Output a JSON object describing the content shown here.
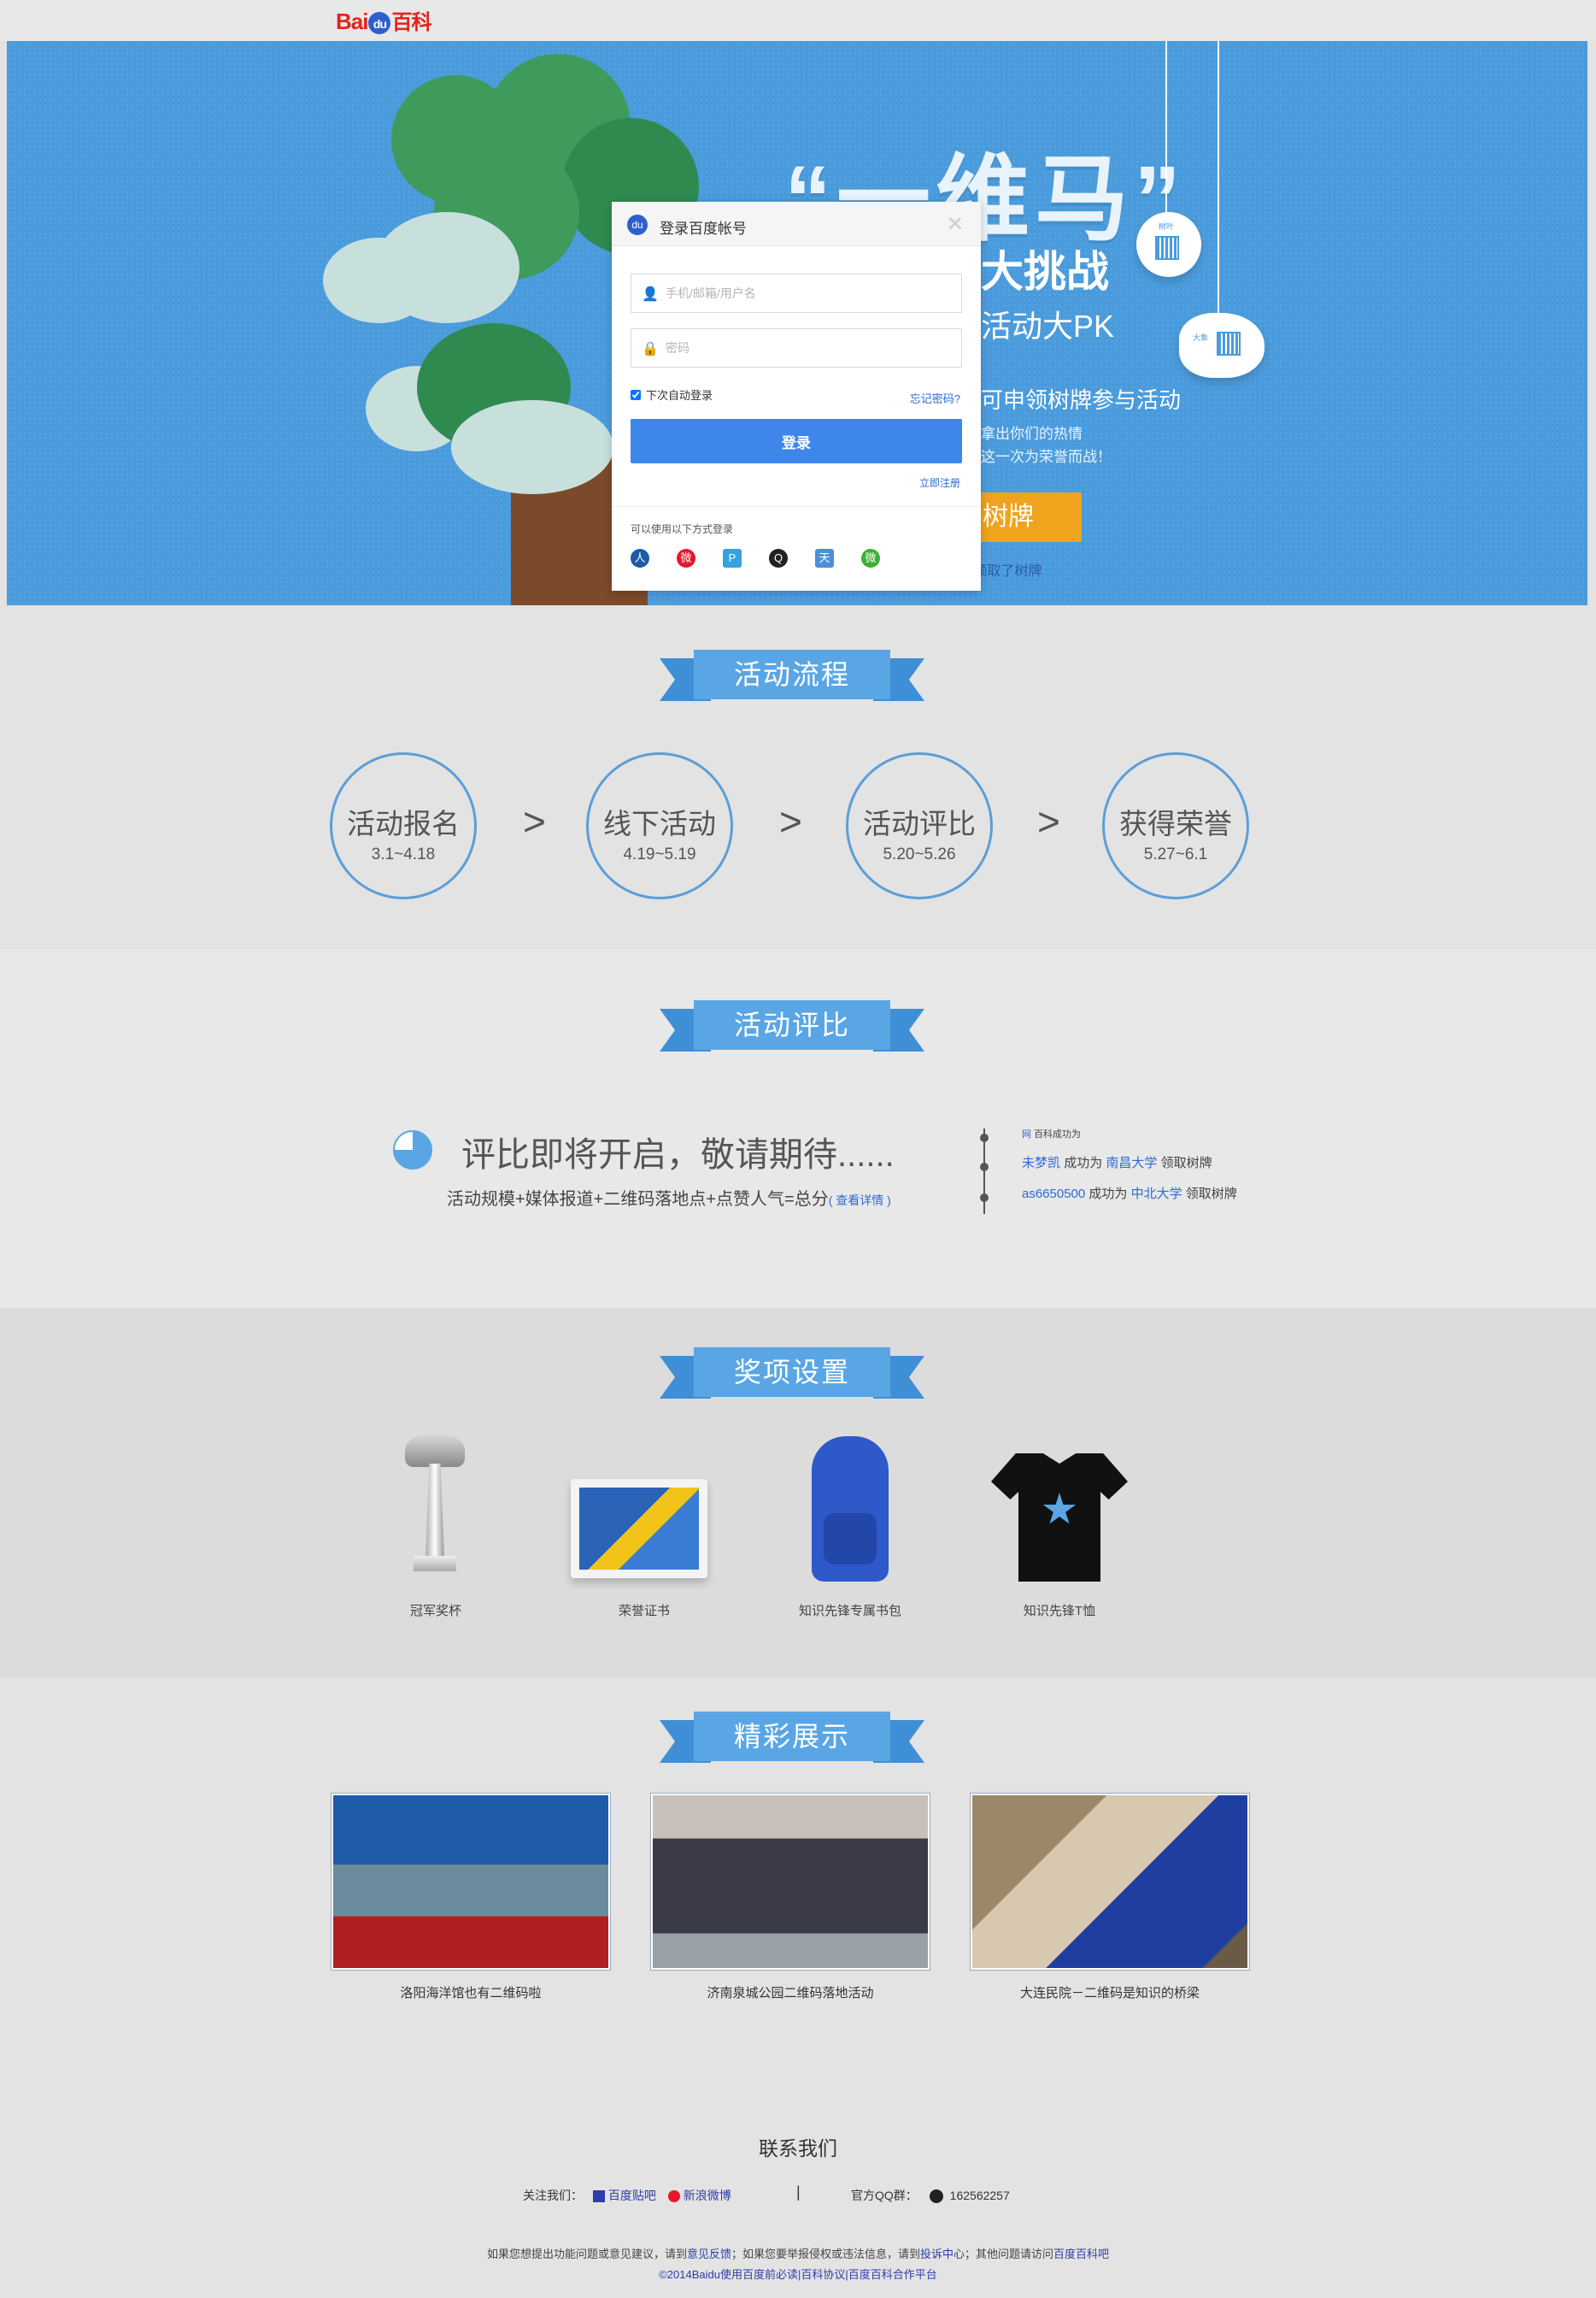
{
  "logo": {
    "bai": "Bai",
    "du": "du",
    "baike": "百科"
  },
  "hero": {
    "title": "“一维马”",
    "subtitle1": "大挑战",
    "subtitle2": "活动大PK",
    "line3": "可申领树牌参与活动",
    "line4": "拿出你们的热情",
    "line5": "这一次为荣誉而战！",
    "button": "树牌",
    "link": "m领取了树牌",
    "tag1": "树叶",
    "tag2": "大象"
  },
  "login": {
    "title": "登录百度帐号",
    "close": "✕",
    "username_placeholder": "手机/邮箱/用户名",
    "password_placeholder": "密码",
    "remember": "下次自动登录",
    "forgot": "忘记密码?",
    "submit": "登录",
    "register": "立即注册",
    "other": "可以使用以下方式登录",
    "socials": [
      {
        "name": "renren",
        "glyph": "人",
        "color": "#1c5aa8"
      },
      {
        "name": "weibo",
        "glyph": "微",
        "color": "#e6162d"
      },
      {
        "name": "pp",
        "glyph": "P",
        "color": "#36a1e0"
      },
      {
        "name": "qq",
        "glyph": "Q",
        "color": "#222222"
      },
      {
        "name": "tianyi",
        "glyph": "天",
        "color": "#4a90d9"
      },
      {
        "name": "wechat",
        "glyph": "微",
        "color": "#3cb034"
      }
    ]
  },
  "flow": {
    "title": "活动流程",
    "steps": [
      {
        "name": "活动报名",
        "date": "3.1~4.18"
      },
      {
        "name": "线下活动",
        "date": "4.19~5.19"
      },
      {
        "name": "活动评比",
        "date": "5.20~5.26"
      },
      {
        "name": "获得荣誉",
        "date": "5.27~6.1"
      }
    ],
    "arrow": ">"
  },
  "evaluate": {
    "title": "活动评比",
    "soon": "评比即将开启，敬请期待......",
    "formula": "活动规模+媒体报道+二维码落地点+点赞人气=总分",
    "detail": "( 查看详情 )",
    "feed": [
      {
        "user": "网",
        "text": "百科成功为",
        "school": "",
        "action": ""
      },
      {
        "user": "未梦凯",
        "text": "成功为",
        "school": "南昌大学",
        "action": "领取树牌"
      },
      {
        "user": "as6650500",
        "text": "成功为",
        "school": "中北大学",
        "action": "领取树牌"
      }
    ]
  },
  "prizes": {
    "title": "奖项设置",
    "items": [
      {
        "label": "冠军奖杯"
      },
      {
        "label": "荣誉证书"
      },
      {
        "label": "知识先锋专属书包"
      },
      {
        "label": "知识先锋T恤"
      }
    ]
  },
  "showcase": {
    "title": "精彩展示",
    "items": [
      {
        "caption": "洛阳海洋馆也有二维码啦"
      },
      {
        "caption": "济南泉城公园二维码落地活动"
      },
      {
        "caption": "大连民院－二维码是知识的桥梁"
      }
    ]
  },
  "contact": {
    "title": "联系我们",
    "follow_label": "关注我们：",
    "tieba": "百度贴吧",
    "weibo": "新浪微博",
    "separator": "|",
    "qq_label": "官方QQ群：",
    "qq_number": "162562257"
  },
  "footer": {
    "line1_a": "如果您想提出功能问题或意见建议，请到",
    "line1_link1": "意见反馈",
    "line1_b": "；如果您要举报侵权或违法信息，请到",
    "line1_link2": "投诉中心",
    "line1_c": "；其他问题请访问",
    "line1_link3": "百度百科吧",
    "copyright": "©2014Baidu",
    "link_a": "使用百度前必读",
    "link_b": "百科协议",
    "link_c": "百度百科合作平台"
  }
}
